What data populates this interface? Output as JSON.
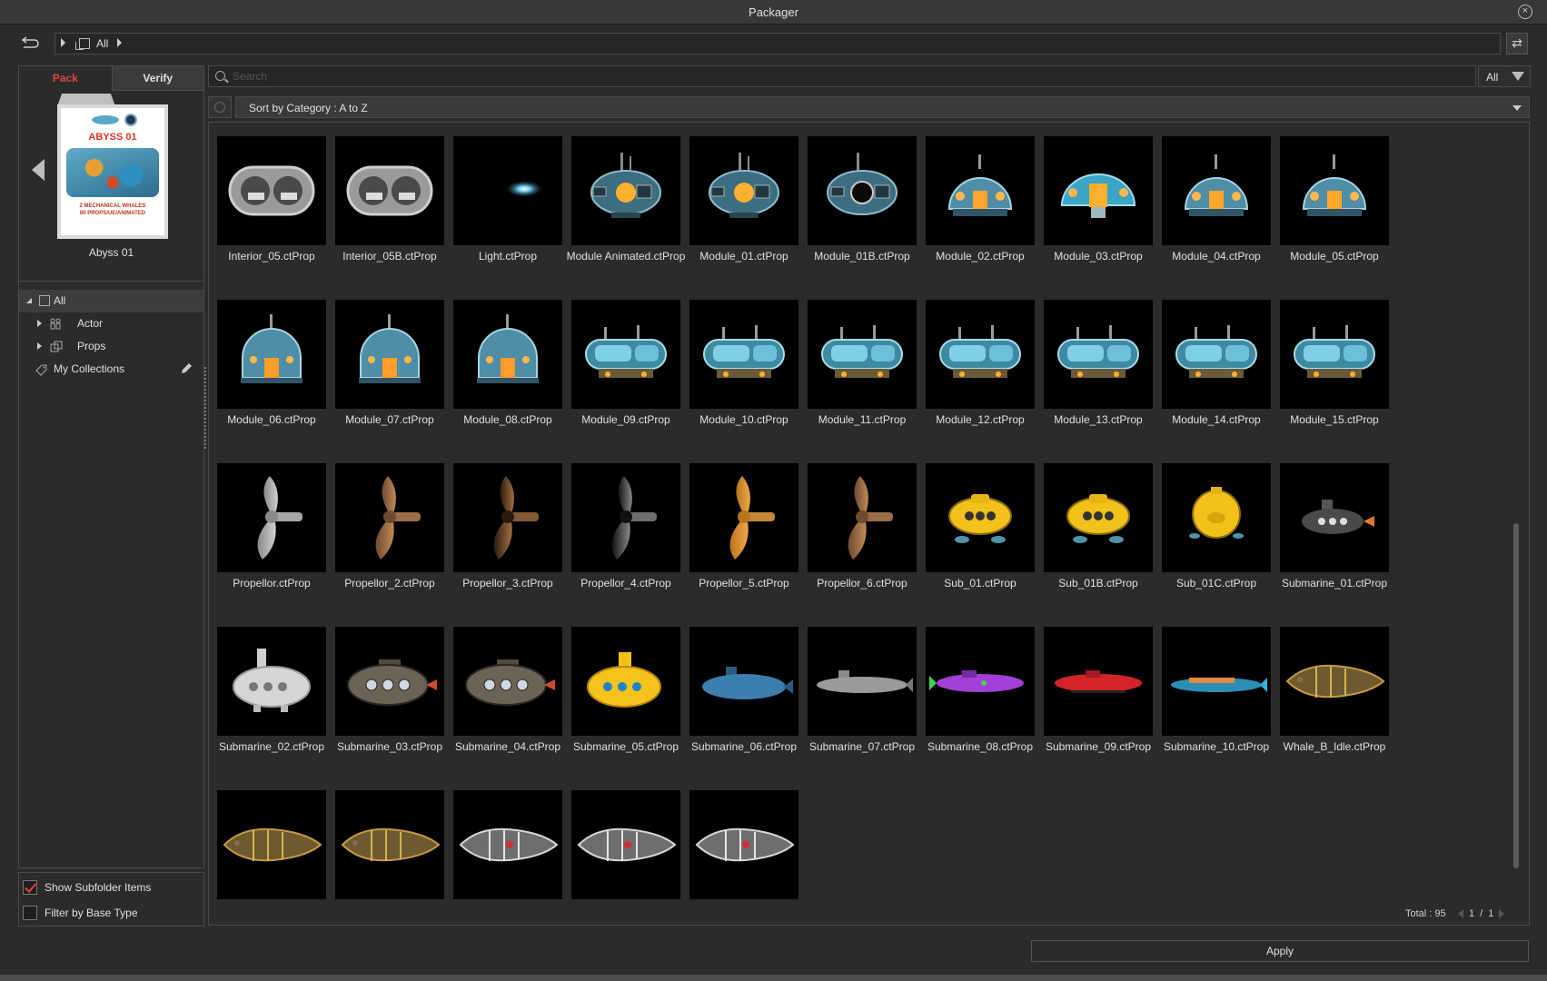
{
  "window": {
    "title": "Packager"
  },
  "path": {
    "label": "All"
  },
  "tabs": {
    "pack": "Pack",
    "verify": "Verify"
  },
  "pack": {
    "name": "Abyss 01",
    "cover_title": "ABYSS 01",
    "cover_subtitle": "2 MECHANICAL WHALES\n80 PROPS/UE/ANIMATED"
  },
  "tree": {
    "all": "All",
    "actor": "Actor",
    "props": "Props",
    "collections": "My Collections"
  },
  "options": {
    "show_subfolder": "Show Subfolder Items",
    "show_subfolder_checked": true,
    "filter_base": "Filter by Base Type",
    "filter_base_checked": false
  },
  "search": {
    "placeholder": "Search",
    "value": ""
  },
  "filter": {
    "label": "All"
  },
  "sort": {
    "label": "Sort by Category : A to Z"
  },
  "items": [
    {
      "label": "Interior_05.ctProp",
      "art": "interior"
    },
    {
      "label": "Interior_05B.ctProp",
      "art": "interior"
    },
    {
      "label": "Light.ctProp",
      "art": "light"
    },
    {
      "label": "Module Animated.ctProp",
      "art": "module_orange"
    },
    {
      "label": "Module_01.ctProp",
      "art": "module_orange"
    },
    {
      "label": "Module_01B.ctProp",
      "art": "module_dark"
    },
    {
      "label": "Module_02.ctProp",
      "art": "dome"
    },
    {
      "label": "Module_03.ctProp",
      "art": "dome_teal"
    },
    {
      "label": "Module_04.ctProp",
      "art": "dome"
    },
    {
      "label": "Module_05.ctProp",
      "art": "dome"
    },
    {
      "label": "Module_06.ctProp",
      "art": "dome_tall"
    },
    {
      "label": "Module_07.ctProp",
      "art": "dome_tall"
    },
    {
      "label": "Module_08.ctProp",
      "art": "dome_tall"
    },
    {
      "label": "Module_09.ctProp",
      "art": "sub_module"
    },
    {
      "label": "Module_10.ctProp",
      "art": "sub_module"
    },
    {
      "label": "Module_11.ctProp",
      "art": "sub_module"
    },
    {
      "label": "Module_12.ctProp",
      "art": "sub_module"
    },
    {
      "label": "Module_13.ctProp",
      "art": "sub_module"
    },
    {
      "label": "Module_14.ctProp",
      "art": "sub_module"
    },
    {
      "label": "Module_15.ctProp",
      "art": "sub_module"
    },
    {
      "label": "Propellor.ctProp",
      "art": "prop_gray"
    },
    {
      "label": "Propellor_2.ctProp",
      "art": "prop_bronze"
    },
    {
      "label": "Propellor_3.ctProp",
      "art": "prop_dark"
    },
    {
      "label": "Propellor_4.ctProp",
      "art": "prop_black"
    },
    {
      "label": "Propellor_5.ctProp",
      "art": "prop_orange"
    },
    {
      "label": "Propellor_6.ctProp",
      "art": "prop_bronze"
    },
    {
      "label": "Sub_01.ctProp",
      "art": "yellow_sub"
    },
    {
      "label": "Sub_01B.ctProp",
      "art": "yellow_sub"
    },
    {
      "label": "Sub_01C.ctProp",
      "art": "yellow_ball"
    },
    {
      "label": "Submarine_01.ctProp",
      "art": "sub_gray_small"
    },
    {
      "label": "Submarine_02.ctProp",
      "art": "sub_white"
    },
    {
      "label": "Submarine_03.ctProp",
      "art": "sub_olive"
    },
    {
      "label": "Submarine_04.ctProp",
      "art": "sub_olive"
    },
    {
      "label": "Submarine_05.ctProp",
      "art": "sub_yellow"
    },
    {
      "label": "Submarine_06.ctProp",
      "art": "sub_blue"
    },
    {
      "label": "Submarine_07.ctProp",
      "art": "sub_gray_long"
    },
    {
      "label": "Submarine_08.ctProp",
      "art": "sub_purple"
    },
    {
      "label": "Submarine_09.ctProp",
      "art": "sub_red"
    },
    {
      "label": "Submarine_10.ctProp",
      "art": "sub_teal"
    },
    {
      "label": "Whale_B_Idle.ctProp",
      "art": "whale_gold"
    },
    {
      "label": "",
      "art": "whale_gold"
    },
    {
      "label": "",
      "art": "whale_gold"
    },
    {
      "label": "",
      "art": "whale_silver"
    },
    {
      "label": "",
      "art": "whale_silver"
    },
    {
      "label": "",
      "art": "whale_silver"
    }
  ],
  "status": {
    "total": "Total : 95",
    "page": "1",
    "sep": "/",
    "pages": "1"
  },
  "apply": {
    "label": "Apply"
  },
  "colors": {
    "accent": "#e0463a",
    "bg": "#2b2b2b"
  }
}
